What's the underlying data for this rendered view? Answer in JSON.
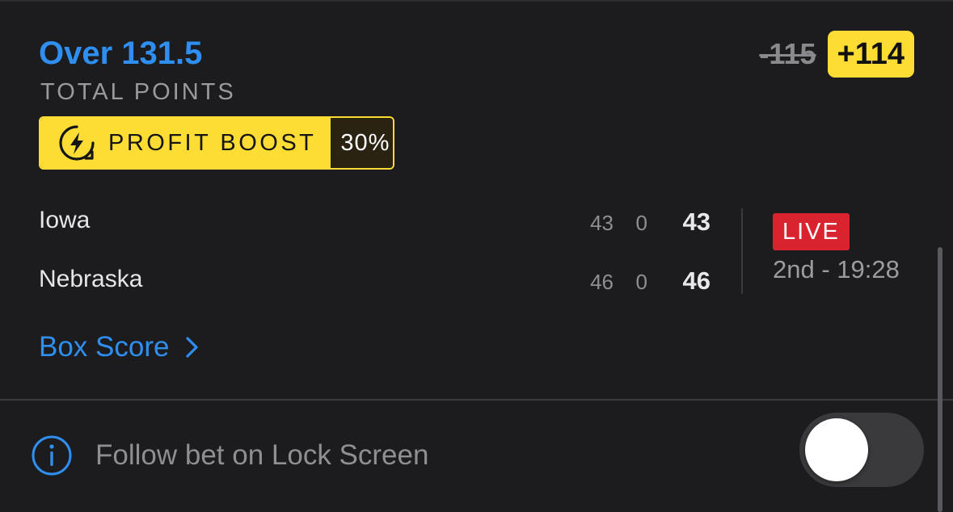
{
  "bet": {
    "selection": "Over 131.5",
    "market": "TOTAL POINTS",
    "original_odds": "-115",
    "boosted_odds": "+114"
  },
  "boost": {
    "label": "PROFIT BOOST",
    "percent": "30%",
    "icon": "lightning-boost-icon",
    "color": "#fddc34"
  },
  "game": {
    "teams": [
      {
        "name": "Iowa",
        "half1": "43",
        "half2": "0",
        "total": "43"
      },
      {
        "name": "Nebraska",
        "half1": "46",
        "half2": "0",
        "total": "46"
      }
    ],
    "status_badge": "LIVE",
    "clock": "2nd - 19:28"
  },
  "links": {
    "box_score": "Box Score"
  },
  "follow": {
    "label": "Follow bet on Lock Screen",
    "toggle_on": false
  },
  "colors": {
    "accent_blue": "#2f8ff0",
    "live_red": "#d9232f",
    "background": "#1c1c1e"
  }
}
